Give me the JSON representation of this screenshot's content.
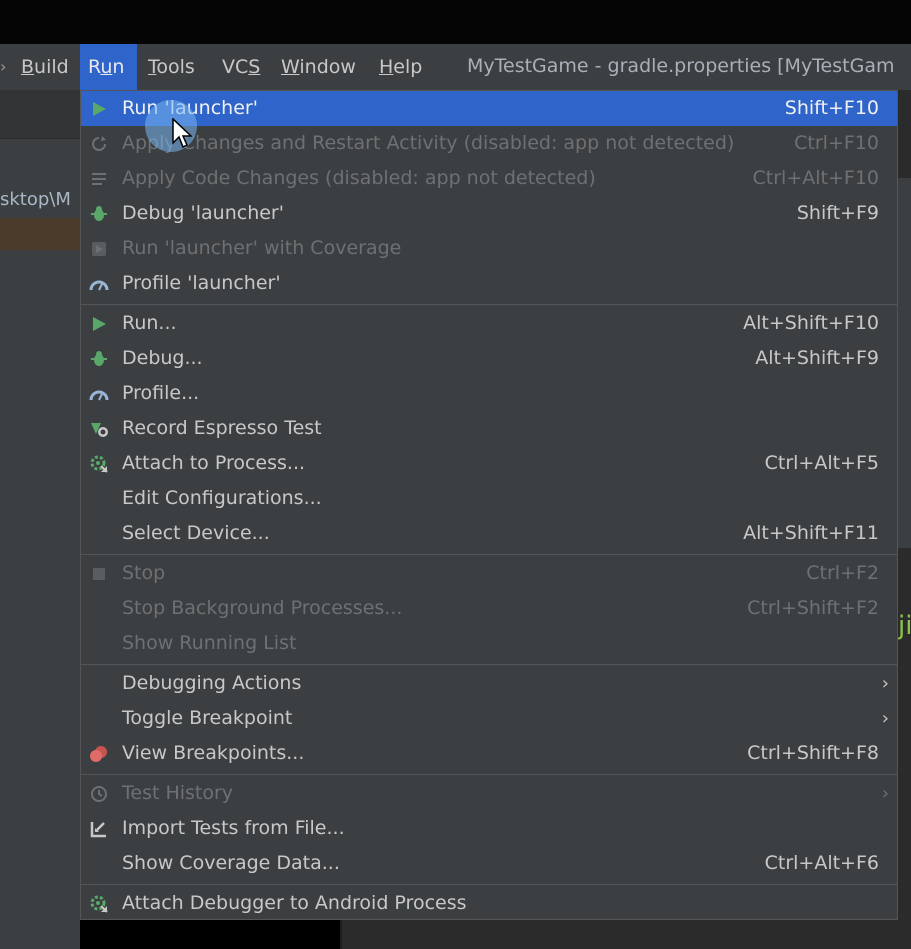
{
  "menubar": {
    "items": [
      {
        "label": "Build",
        "mn": "B",
        "rest": "uild"
      },
      {
        "label": "Run",
        "pre": "R",
        "mn": "u",
        "rest": "n"
      },
      {
        "label": "Tools",
        "mn": "T",
        "rest": "ools"
      },
      {
        "label": "VCS",
        "pre": "VC",
        "mn": "S",
        "rest": ""
      },
      {
        "label": "Window",
        "mn": "W",
        "rest": "indow"
      },
      {
        "label": "Help",
        "mn": "H",
        "rest": "elp"
      }
    ],
    "title": "MyTestGame - gradle.properties [MyTestGam"
  },
  "left_panel": {
    "path_text": "sktop\\M"
  },
  "right_panel": {
    "glyph": "ji"
  },
  "run_menu": {
    "items": [
      {
        "id": "run-launcher",
        "label": "Run 'launcher'",
        "shortcut": "Shift+F10",
        "icon": "run-icon"
      },
      {
        "id": "apply-changes-restart",
        "label": "Apply Changes and Restart Activity (disabled: app not detected)",
        "shortcut": "Ctrl+F10",
        "icon": "apply-changes-icon"
      },
      {
        "id": "apply-code-changes",
        "label": "Apply Code Changes (disabled: app not detected)",
        "shortcut": "Ctrl+Alt+F10",
        "icon": "apply-code-icon"
      },
      {
        "id": "debug-launcher",
        "label": "Debug 'launcher'",
        "shortcut": "Shift+F9",
        "icon": "debug-icon"
      },
      {
        "id": "run-with-coverage",
        "label": "Run 'launcher' with Coverage",
        "shortcut": "",
        "icon": "coverage-icon"
      },
      {
        "id": "profile-launcher",
        "label": "Profile 'launcher'",
        "shortcut": "",
        "icon": "profile-icon"
      },
      {
        "id": "run-dots",
        "label": "Run...",
        "shortcut": "Alt+Shift+F10",
        "icon": "run-icon"
      },
      {
        "id": "debug-dots",
        "label": "Debug...",
        "shortcut": "Alt+Shift+F9",
        "icon": "debug-icon"
      },
      {
        "id": "profile-dots",
        "label": "Profile...",
        "shortcut": "",
        "icon": "profile-icon"
      },
      {
        "id": "record-espresso",
        "label": "Record Espresso Test",
        "shortcut": "",
        "icon": "espresso-icon"
      },
      {
        "id": "attach-process",
        "label": "Attach to Process...",
        "shortcut": "Ctrl+Alt+F5",
        "icon": "attach-icon"
      },
      {
        "id": "edit-configurations",
        "label": "Edit Configurations...",
        "shortcut": "",
        "icon": ""
      },
      {
        "id": "select-device",
        "label": "Select Device...",
        "shortcut": "Alt+Shift+F11",
        "icon": ""
      },
      {
        "id": "stop",
        "label": "Stop",
        "shortcut": "Ctrl+F2",
        "icon": "stop-icon"
      },
      {
        "id": "stop-background",
        "label": "Stop Background Processes...",
        "shortcut": "Ctrl+Shift+F2",
        "icon": ""
      },
      {
        "id": "show-running-list",
        "label": "Show Running List",
        "shortcut": "",
        "icon": ""
      },
      {
        "id": "debugging-actions",
        "label": "Debugging Actions",
        "shortcut": "",
        "icon": ""
      },
      {
        "id": "toggle-breakpoint",
        "label": "Toggle Breakpoint",
        "shortcut": "",
        "icon": ""
      },
      {
        "id": "view-breakpoints",
        "label": "View Breakpoints...",
        "shortcut": "Ctrl+Shift+F8",
        "icon": "breakpoints-icon"
      },
      {
        "id": "test-history",
        "label": "Test History",
        "shortcut": "",
        "icon": "history-icon"
      },
      {
        "id": "import-tests",
        "label": "Import Tests from File...",
        "shortcut": "",
        "icon": "import-icon"
      },
      {
        "id": "show-coverage",
        "label": "Show Coverage Data...",
        "shortcut": "Ctrl+Alt+F6",
        "icon": ""
      },
      {
        "id": "attach-debugger",
        "label": "Attach Debugger to Android Process",
        "shortcut": "",
        "icon": "attach-debugger-icon"
      }
    ],
    "submenu_arrow": "›"
  },
  "colors": {
    "menu_bg": "#3c3f41",
    "selection": "#2f65ca",
    "text": "#c8c8c8",
    "disabled_text": "#6e7173",
    "run_green": "#4caf50"
  }
}
